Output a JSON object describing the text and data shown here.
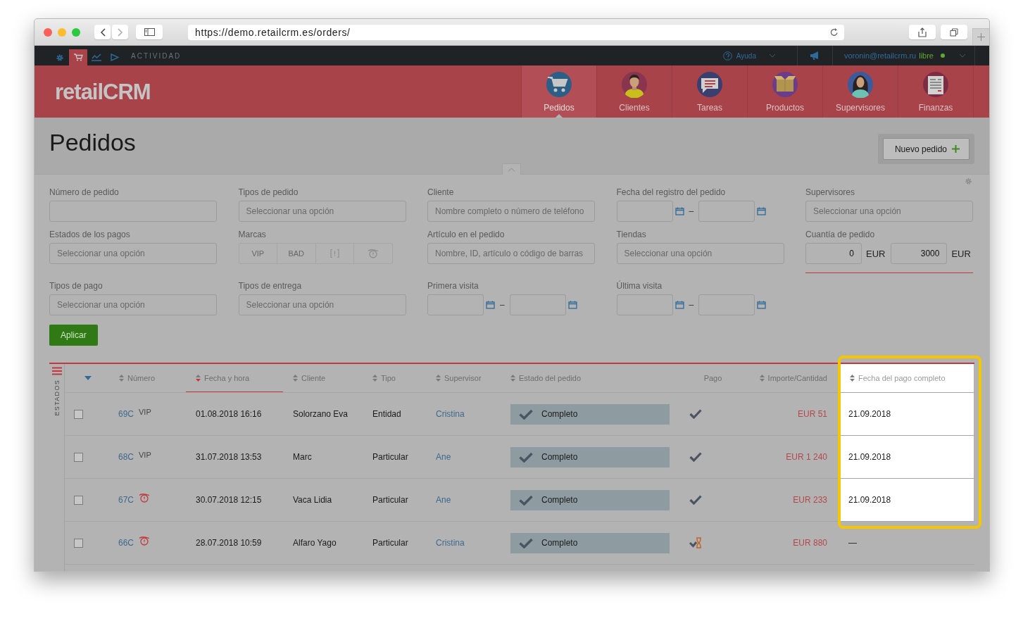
{
  "browser": {
    "url": "https://demo.retailcrm.es/orders/"
  },
  "topbar": {
    "icons": [
      {
        "kind": "settings",
        "selected": false
      },
      {
        "kind": "cart",
        "selected": true
      },
      {
        "kind": "chart",
        "selected": false
      },
      {
        "kind": "play",
        "selected": false
      }
    ],
    "section": "ACTIVIDAD",
    "help": "Ayuda",
    "user": "voronin@retailcrm.ru",
    "plan": "libre",
    "online": true
  },
  "logo": "retailCRM",
  "nav": [
    {
      "label": "Pedidos",
      "kind": "cart",
      "selected": true
    },
    {
      "label": "Clientes",
      "kind": "man",
      "selected": false
    },
    {
      "label": "Tareas",
      "kind": "chat",
      "selected": false
    },
    {
      "label": "Productos",
      "kind": "box",
      "selected": false
    },
    {
      "label": "Supervisores",
      "kind": "woman",
      "selected": false
    },
    {
      "label": "Finanzas",
      "kind": "sheet",
      "selected": false
    }
  ],
  "page": {
    "title": "Pedidos",
    "new_button": "Nuevo pedido"
  },
  "filters": [
    {
      "label": "Número de pedido",
      "kind": "text"
    },
    {
      "label": "Tipos de pedido",
      "kind": "select",
      "placeholder": "Seleccionar una opción"
    },
    {
      "label": "Cliente",
      "kind": "text",
      "placeholder": "Nombre completo o número de teléfono"
    },
    {
      "label": "Fecha del registro del pedido",
      "kind": "date_range",
      "separator": "–"
    },
    {
      "label": "Supervisores",
      "kind": "select",
      "placeholder": "Seleccionar una opción"
    },
    {
      "label": "Estados de los pagos",
      "kind": "select",
      "placeholder": "Seleccionar una opción"
    },
    {
      "label": "Marcas",
      "kind": "marks",
      "options": [
        {
          "kind": "text",
          "label": "VIP",
          "selected": false
        },
        {
          "kind": "text",
          "label": "BAD",
          "selected": false
        },
        {
          "kind": "alert",
          "selected": false
        },
        {
          "kind": "alarm",
          "selected": false
        }
      ]
    },
    {
      "label": "Artículo en el pedido",
      "kind": "text",
      "placeholder": "Nombre, ID, artículo o código de barras"
    },
    {
      "label": "Tiendas",
      "kind": "select",
      "placeholder": "Seleccionar una opción"
    },
    {
      "label": "Cuantía de pedido",
      "kind": "amount",
      "from": {
        "value": "0",
        "currency": "EUR"
      },
      "to": {
        "value": "3000",
        "currency": "EUR"
      }
    },
    {
      "label": "Tipos de pago",
      "kind": "select",
      "placeholder": "Seleccionar una opción"
    },
    {
      "label": "Tipos de entrega",
      "kind": "select",
      "placeholder": "Seleccionar una opción"
    },
    {
      "label": "Primera visita",
      "kind": "date_range",
      "separator": "–"
    },
    {
      "label": "Última visita",
      "kind": "date_range",
      "separator": "–"
    }
  ],
  "apply_button": "Aplicar",
  "table": {
    "sidebar_label": "ESTADOS",
    "columns": [
      {
        "label": "Número",
        "sortable": true,
        "selected": false,
        "highlighted": false
      },
      {
        "label": "Fecha y hora",
        "sortable": true,
        "selected": true,
        "highlighted": false
      },
      {
        "label": "Cliente",
        "sortable": true,
        "selected": false,
        "highlighted": false
      },
      {
        "label": "Tipo",
        "sortable": true,
        "selected": false,
        "highlighted": false
      },
      {
        "label": "Supervisor",
        "sortable": true,
        "selected": false,
        "highlighted": false
      },
      {
        "label": "Estado del pedido",
        "sortable": true,
        "selected": false,
        "highlighted": false
      },
      {
        "label": "Pago",
        "sortable": false,
        "selected": false,
        "highlighted": false
      },
      {
        "label": "Importe/Cantidad",
        "sortable": true,
        "selected": false,
        "highlighted": false
      },
      {
        "label": "Fecha del pago completo",
        "sortable": true,
        "selected": false,
        "highlighted": true
      }
    ],
    "rows": [
      {
        "checked": false,
        "number": "69C",
        "mark": {
          "kind": "text",
          "label": "VIP"
        },
        "date": "01.08.2018 16:16",
        "client": "Solorzano Eva",
        "type": "Entidad",
        "supervisor": "Cristina",
        "status": "Completo",
        "payment_complete": true,
        "amount": "EUR 51",
        "payment_date": "21.09.2018"
      },
      {
        "checked": false,
        "number": "68C",
        "mark": {
          "kind": "text",
          "label": "VIP"
        },
        "date": "31.07.2018 13:53",
        "client": "Marc",
        "type": "Particular",
        "supervisor": "Ane",
        "status": "Completo",
        "payment_complete": true,
        "amount": "EUR 1 240",
        "payment_date": "21.09.2018"
      },
      {
        "checked": false,
        "number": "67C",
        "mark": {
          "kind": "alarm"
        },
        "date": "30.07.2018 12:15",
        "client": "Vaca Lidia",
        "type": "Particular",
        "supervisor": "Ane",
        "status": "Completo",
        "payment_complete": true,
        "amount": "EUR 233",
        "payment_date": "21.09.2018"
      },
      {
        "checked": false,
        "number": "66C",
        "mark": {
          "kind": "alarm"
        },
        "date": "28.07.2018 10:59",
        "client": "Alfaro Yago",
        "type": "Particular",
        "supervisor": "Cristina",
        "status": "Completo",
        "payment_complete": false,
        "amount": "EUR 880",
        "payment_date": "—"
      }
    ]
  }
}
